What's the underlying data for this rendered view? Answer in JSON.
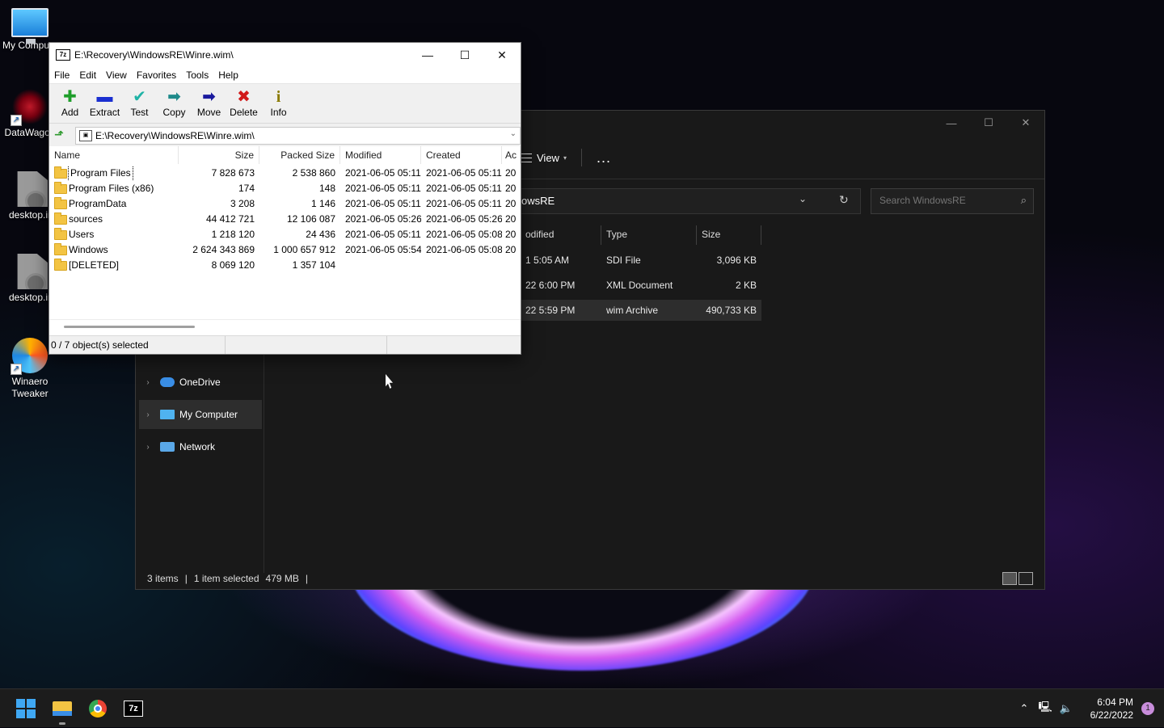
{
  "desktop": {
    "icons": [
      {
        "label": "My Compute"
      },
      {
        "label": "DataWagon"
      },
      {
        "label": "desktop.ir"
      },
      {
        "label": "desktop.ir"
      },
      {
        "label": "Winaero Tweaker"
      }
    ]
  },
  "explorer": {
    "toolbar": {
      "view_label": "View",
      "more_label": "..."
    },
    "address": "owsRE",
    "search_placeholder": "Search WindowsRE",
    "columns": [
      "odified",
      "Type",
      "Size"
    ],
    "rows": [
      {
        "modified": "1 5:05 AM",
        "type": "SDI File",
        "size": "3,096 KB"
      },
      {
        "modified": "22 6:00 PM",
        "type": "XML Document",
        "size": "2 KB"
      },
      {
        "modified": "22 5:59 PM",
        "type": "wim Archive",
        "size": "490,733 KB"
      }
    ],
    "nav": [
      {
        "label": "OneDrive",
        "color": "#3a8ee6"
      },
      {
        "label": "My Computer",
        "color": "#4fb3f0"
      },
      {
        "label": "Network",
        "color": "#5aa8e8"
      }
    ],
    "status": {
      "items": "3 items",
      "selected": "1 item selected",
      "size": "479 MB"
    }
  },
  "zip": {
    "title": "E:\\Recovery\\WindowsRE\\Winre.wim\\",
    "menu": [
      "File",
      "Edit",
      "View",
      "Favorites",
      "Tools",
      "Help"
    ],
    "tools": [
      {
        "label": "Add",
        "color": "#1e9e2a",
        "icon": "plus-icon"
      },
      {
        "label": "Extract",
        "color": "#1a2fd1",
        "icon": "minus-icon"
      },
      {
        "label": "Test",
        "color": "#1fb3a6",
        "icon": "check-icon"
      },
      {
        "label": "Copy",
        "color": "#1f8a8a",
        "icon": "arrow-right-icon"
      },
      {
        "label": "Move",
        "color": "#1a1a9e",
        "icon": "arrow-right-icon"
      },
      {
        "label": "Delete",
        "color": "#d11a1a",
        "icon": "x-icon"
      },
      {
        "label": "Info",
        "color": "#8a7a00",
        "icon": "info-icon"
      }
    ],
    "address": "E:\\Recovery\\WindowsRE\\Winre.wim\\",
    "columns": [
      "Name",
      "Size",
      "Packed Size",
      "Modified",
      "Created",
      "Ac"
    ],
    "rows": [
      {
        "name": "Program Files",
        "size": "7 828 673",
        "packed": "2 538 860",
        "modified": "2021-06-05 05:11",
        "created": "2021-06-05 05:11",
        "accessed": "20"
      },
      {
        "name": "Program Files (x86)",
        "size": "174",
        "packed": "148",
        "modified": "2021-06-05 05:11",
        "created": "2021-06-05 05:11",
        "accessed": "20"
      },
      {
        "name": "ProgramData",
        "size": "3 208",
        "packed": "1 146",
        "modified": "2021-06-05 05:11",
        "created": "2021-06-05 05:11",
        "accessed": "20"
      },
      {
        "name": "sources",
        "size": "44 412 721",
        "packed": "12 106 087",
        "modified": "2021-06-05 05:26",
        "created": "2021-06-05 05:26",
        "accessed": "20"
      },
      {
        "name": "Users",
        "size": "1 218 120",
        "packed": "24 436",
        "modified": "2021-06-05 05:11",
        "created": "2021-06-05 05:08",
        "accessed": "20"
      },
      {
        "name": "Windows",
        "size": "2 624 343 869",
        "packed": "1 000 657 912",
        "modified": "2021-06-05 05:54",
        "created": "2021-06-05 05:08",
        "accessed": "20"
      },
      {
        "name": "[DELETED]",
        "size": "8 069 120",
        "packed": "1 357 104",
        "modified": "",
        "created": "",
        "accessed": ""
      }
    ],
    "status": "0 / 7 object(s) selected"
  },
  "taskbar": {
    "time": "6:04 PM",
    "date": "6/22/2022",
    "notification_count": "1"
  }
}
